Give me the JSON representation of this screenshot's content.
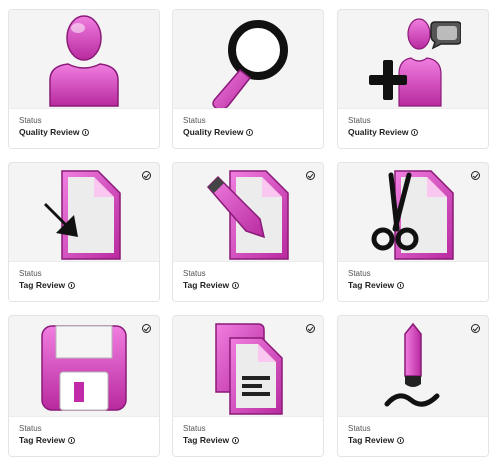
{
  "colors": {
    "accent": "#d23fb8",
    "accent_dark": "#9a1d86",
    "card_bg": "#f4f4f4"
  },
  "cards": [
    {
      "icon": "user-icon",
      "status_label": "Status",
      "status_value": "Quality Review",
      "checked": false
    },
    {
      "icon": "search-icon",
      "status_label": "Status",
      "status_value": "Quality Review",
      "checked": false
    },
    {
      "icon": "add-user-icon",
      "status_label": "Status",
      "status_value": "Quality Review",
      "checked": false
    },
    {
      "icon": "import-document-icon",
      "status_label": "Status",
      "status_value": "Tag Review",
      "checked": true
    },
    {
      "icon": "edit-document-icon",
      "status_label": "Status",
      "status_value": "Tag Review",
      "checked": true
    },
    {
      "icon": "cut-document-icon",
      "status_label": "Status",
      "status_value": "Tag Review",
      "checked": true
    },
    {
      "icon": "save-icon",
      "status_label": "Status",
      "status_value": "Tag Review",
      "checked": true
    },
    {
      "icon": "copy-document-icon",
      "status_label": "Status",
      "status_value": "Tag Review",
      "checked": true
    },
    {
      "icon": "signature-pen-icon",
      "status_label": "Status",
      "status_value": "Tag Review",
      "checked": true
    }
  ]
}
